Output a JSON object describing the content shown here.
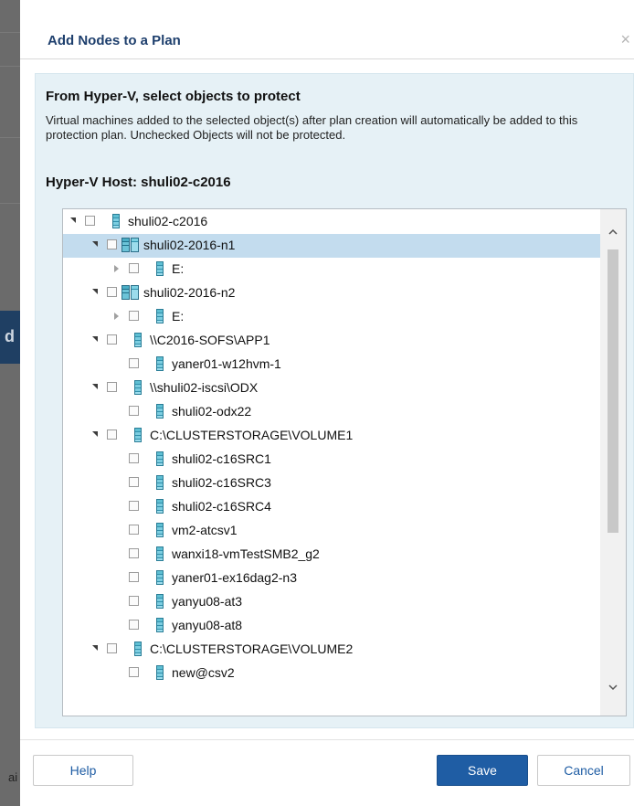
{
  "dialog": {
    "title": "Add Nodes to a Plan",
    "close": "×"
  },
  "content": {
    "heading": "From Hyper-V, select objects to protect",
    "description": "Virtual machines added to the selected object(s) after plan creation will automatically be added to this protection plan. Unchecked Objects will not be protected.",
    "host_title": "Hyper-V Host: shuli02-c2016"
  },
  "tree": {
    "rows": [
      {
        "label": "shuli02-c2016",
        "icon": "server-icon"
      },
      {
        "label": "shuli02-2016-n1",
        "icon": "cluster-node-icon"
      },
      {
        "label": "E:",
        "icon": "server-icon"
      },
      {
        "label": "shuli02-2016-n2",
        "icon": "cluster-node-icon"
      },
      {
        "label": "E:",
        "icon": "server-icon"
      },
      {
        "label": "\\\\C2016-SOFS\\APP1",
        "icon": "server-icon"
      },
      {
        "label": "yaner01-w12hvm-1",
        "icon": "server-icon"
      },
      {
        "label": "\\\\shuli02-iscsi\\ODX",
        "icon": "server-icon"
      },
      {
        "label": "shuli02-odx22",
        "icon": "server-icon"
      },
      {
        "label": "C:\\CLUSTERSTORAGE\\VOLUME1",
        "icon": "server-icon"
      },
      {
        "label": "shuli02-c16SRC1",
        "icon": "server-icon"
      },
      {
        "label": "shuli02-c16SRC3",
        "icon": "server-icon"
      },
      {
        "label": "shuli02-c16SRC4",
        "icon": "server-icon"
      },
      {
        "label": "vm2-atcsv1",
        "icon": "server-icon"
      },
      {
        "label": "wanxi18-vmTestSMB2_g2",
        "icon": "server-icon"
      },
      {
        "label": "yaner01-ex16dag2-n3",
        "icon": "server-icon"
      },
      {
        "label": "yanyu08-at3",
        "icon": "server-icon"
      },
      {
        "label": "yanyu08-at8",
        "icon": "server-icon"
      },
      {
        "label": "C:\\CLUSTERSTORAGE\\VOLUME2",
        "icon": "server-icon"
      },
      {
        "label": "new@csv2",
        "icon": "server-icon"
      }
    ],
    "selected_label": "shuli02-2016-n1"
  },
  "footer": {
    "help": "Help",
    "save": "Save",
    "cancel": "Cancel"
  },
  "colors": {
    "title": "#1e3f6d",
    "panel_bg": "#e6f1f6",
    "selected_row": "#c3dcee",
    "primary_button": "#1f5da4"
  }
}
